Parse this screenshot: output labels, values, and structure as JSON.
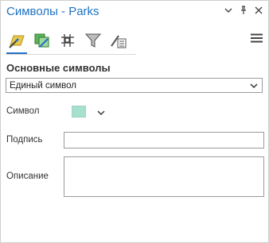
{
  "pane": {
    "title": "Символы - Parks",
    "tabs": [
      {
        "name": "primary-symbology"
      },
      {
        "name": "symbol-classes"
      },
      {
        "name": "vary-symbology"
      },
      {
        "name": "symbol-filter"
      },
      {
        "name": "advanced-symbol-options"
      }
    ]
  },
  "section": {
    "title": "Основные символы",
    "dropdown_value": "Единый символ"
  },
  "fields": {
    "symbol_label": "Символ",
    "label_label": "Подпись",
    "description_label": "Описание",
    "label_value": "",
    "description_value": ""
  },
  "colors": {
    "accent": "#1f72c4",
    "symbol_fill": "#a8e0d0"
  }
}
